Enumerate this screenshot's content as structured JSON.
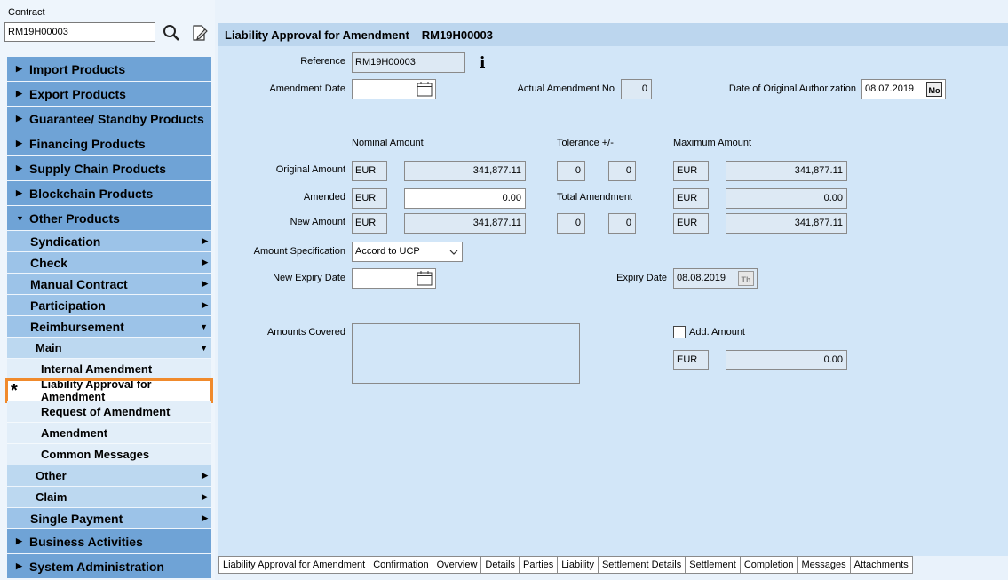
{
  "contract": {
    "label": "Contract",
    "value": "RM19H00003"
  },
  "nav": {
    "top_before": [
      {
        "label": "Import Products",
        "arrow": "▶"
      },
      {
        "label": "Export Products",
        "arrow": "▶"
      },
      {
        "label": "Guarantee/ Standby Products",
        "arrow": "▶"
      },
      {
        "label": "Financing Products",
        "arrow": "▶"
      },
      {
        "label": "Supply Chain Products",
        "arrow": "▶"
      },
      {
        "label": "Blockchain Products",
        "arrow": "▶"
      },
      {
        "label": "Other Products",
        "arrow": "▼"
      }
    ],
    "other_sub": [
      {
        "label": "Syndication",
        "arrow": "▶"
      },
      {
        "label": "Check",
        "arrow": "▶"
      },
      {
        "label": "Manual Contract",
        "arrow": "▶"
      },
      {
        "label": "Participation",
        "arrow": "▶"
      },
      {
        "label": "Reimbursement",
        "arrow": "▼"
      }
    ],
    "reimb_main": {
      "label": "Main",
      "arrow": "▼"
    },
    "leaves": [
      {
        "label": "Internal Amendment"
      },
      {
        "label": "Liability Approval for Amendment",
        "star": "*"
      },
      {
        "label": "Request of Amendment"
      },
      {
        "label": "Amendment"
      },
      {
        "label": "Common Messages"
      }
    ],
    "reimb_other": [
      {
        "label": "Other",
        "arrow": "▶"
      },
      {
        "label": "Claim",
        "arrow": "▶"
      }
    ],
    "single_payment": {
      "label": "Single Payment",
      "arrow": "▶"
    },
    "top_after": [
      {
        "label": "Business Activities",
        "arrow": "▶"
      },
      {
        "label": "System Administration",
        "arrow": "▶"
      }
    ]
  },
  "main": {
    "title": "Liability Approval for Amendment",
    "ref": "RM19H00003",
    "info_icon": "i",
    "reference": {
      "label": "Reference",
      "value": "RM19H00003"
    },
    "amendment_date": {
      "label": "Amendment Date",
      "value": ""
    },
    "actual_amendment_no": {
      "label": "Actual Amendment No",
      "value": "0"
    },
    "date_orig_auth": {
      "label": "Date of Original Authorization",
      "value": "08.07.2019",
      "cal_text": "Mo"
    },
    "headers": {
      "nominal": "Nominal Amount",
      "tolerance": "Tolerance +/-",
      "maximum": "Maximum Amount",
      "total_amendment": "Total Amendment"
    },
    "original_amount": {
      "label": "Original Amount",
      "ccy": "EUR",
      "amount": "341,877.11",
      "tol_plus": "0",
      "tol_minus": "0",
      "max_ccy": "EUR",
      "max_amount": "341,877.11"
    },
    "amended": {
      "label": "Amended",
      "ccy": "EUR",
      "amount": "0.00",
      "max_ccy": "EUR",
      "max_amount": "0.00"
    },
    "new_amount": {
      "label": "New Amount",
      "ccy": "EUR",
      "amount": "341,877.11",
      "tol_plus": "0",
      "tol_minus": "0",
      "max_ccy": "EUR",
      "max_amount": "341,877.11"
    },
    "amount_spec": {
      "label": "Amount Specification",
      "value": "Accord to UCP"
    },
    "new_expiry": {
      "label": "New Expiry Date",
      "value": ""
    },
    "expiry_date": {
      "label": "Expiry Date",
      "value": "08.08.2019",
      "cal_text": "Th"
    },
    "amounts_covered": {
      "label": "Amounts Covered",
      "value": ""
    },
    "add_amount": {
      "label": "Add. Amount",
      "ccy": "EUR",
      "amount": "0.00"
    }
  },
  "tabs": [
    "Liability Approval for Amendment",
    "Confirmation",
    "Overview",
    "Details",
    "Parties",
    "Liability",
    "Settlement Details",
    "Settlement",
    "Completion",
    "Messages",
    "Attachments"
  ]
}
